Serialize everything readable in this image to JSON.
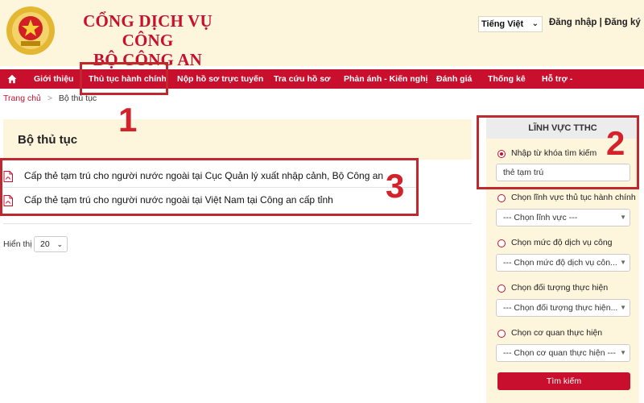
{
  "header": {
    "title_line1": "CỔNG DỊCH VỤ CÔNG",
    "title_line2": "BỘ CÔNG AN",
    "language": "Tiếng Việt",
    "login": "Đăng nhập",
    "separator": "|",
    "register": "Đăng ký"
  },
  "nav": {
    "items": [
      {
        "label": "Giới thiệu"
      },
      {
        "label": "Thủ tục hành chính"
      },
      {
        "label": "Nộp hồ sơ trực tuyến"
      },
      {
        "label": "Tra cứu hồ sơ"
      },
      {
        "label": "Phản ánh - Kiến nghị"
      },
      {
        "label": "Đánh giá"
      },
      {
        "label": "Thống kê"
      },
      {
        "label": "Hỗ trợ -"
      }
    ]
  },
  "breadcrumb": {
    "home": "Trang chủ",
    "sep": ">",
    "current": "Bộ thủ tục"
  },
  "main": {
    "title": "Bộ thủ tục",
    "results": [
      {
        "title": "Cấp thẻ tạm trú cho người nước ngoài tại Cục Quản lý xuất nhập cảnh, Bộ Công an"
      },
      {
        "title": "Cấp thẻ tạm trú cho người nước ngoài tại Việt Nam tại Công an cấp tỉnh"
      }
    ],
    "per_page_label": "Hiển thị",
    "per_page_value": "20"
  },
  "sidebar": {
    "title": "LĨNH VỰC TTHC",
    "keyword_label": "Nhập từ khóa tìm kiếm",
    "keyword_value": "thẻ tạm trú",
    "field_label": "Chọn lĩnh vực thủ tục hành chính",
    "field_value": "--- Chọn lĩnh vực ---",
    "level_label": "Chọn mức độ dịch vụ công",
    "level_value": "--- Chọn mức độ dịch vụ côn...",
    "subject_label": "Chọn đối tượng thực hiện",
    "subject_value": "--- Chọn đối tượng thực hiện...",
    "agency_label": "Chọn cơ quan thực hiện",
    "agency_value": "--- Chọn cơ quan thực hiện ---",
    "search_button": "Tìm kiếm"
  },
  "annotations": {
    "one": "1",
    "two": "2",
    "three": "3"
  },
  "colors": {
    "brand_red": "#c8102e",
    "header_bg": "#fdf5dc",
    "annotation": "#c0282f"
  }
}
